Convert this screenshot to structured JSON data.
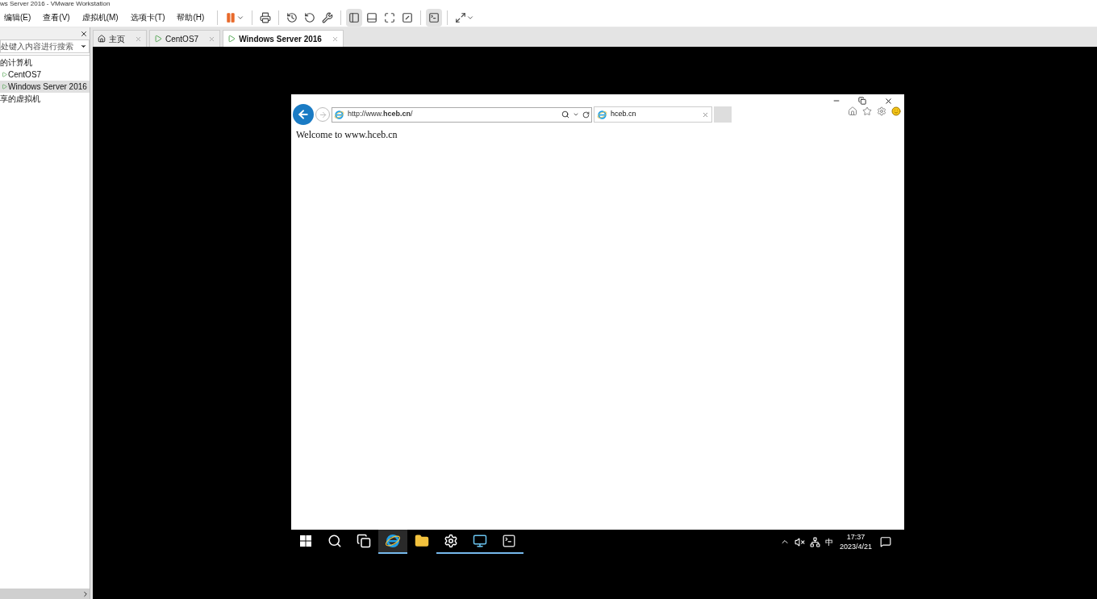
{
  "window": {
    "title": "ws Server 2016 - VMware Workstation"
  },
  "menu": [
    "编辑(E)",
    "查看(V)",
    "虚拟机(M)",
    "选项卡(T)",
    "帮助(H)"
  ],
  "toolbar": [
    {
      "kind": "pause",
      "selected": false
    },
    {
      "kind": "send-keys",
      "selected": false
    },
    {
      "kind": "snapshot",
      "selected": false
    },
    {
      "kind": "revert",
      "selected": false
    },
    {
      "kind": "manage",
      "selected": false
    },
    {
      "kind": "sidebar",
      "selected": true
    },
    {
      "kind": "thumb",
      "selected": false
    },
    {
      "kind": "fullscreen",
      "selected": false
    },
    {
      "kind": "unity",
      "selected": false
    },
    {
      "kind": "console",
      "selected": true
    },
    {
      "kind": "stretch",
      "selected": false
    }
  ],
  "library": {
    "search": {
      "placeholder": "处键入内容进行搜索"
    },
    "items": [
      {
        "label": "的计算机",
        "selected": false,
        "children": [
          {
            "label": "CentOS7",
            "kind": "vm",
            "selected": false
          },
          {
            "label": "Windows Server 2016",
            "kind": "vm",
            "selected": true
          }
        ]
      },
      {
        "label": "享的虚拟机",
        "selected": false
      }
    ]
  },
  "tabs": [
    {
      "label": "主页",
      "kind": "home",
      "selected": false
    },
    {
      "label": "CentOS7",
      "kind": "vm",
      "selected": false
    },
    {
      "label": "Windows Server 2016",
      "kind": "vm",
      "selected": true
    }
  ],
  "browser": {
    "address": "http://www.**hceb.cn**/",
    "tab": "hceb.cn",
    "content": "Welcome to www.hceb.cn"
  },
  "taskbar": {
    "apps": [
      {
        "kind": "start",
        "selected": false,
        "running": false
      },
      {
        "kind": "search",
        "selected": false,
        "running": false
      },
      {
        "kind": "taskview",
        "selected": false,
        "running": false
      },
      {
        "kind": "ie",
        "selected": true,
        "running": true
      },
      {
        "kind": "explorer",
        "selected": false,
        "running": false
      },
      {
        "kind": "settings",
        "selected": false,
        "running": true
      },
      {
        "kind": "server",
        "selected": false,
        "running": true
      },
      {
        "kind": "cmd",
        "selected": false,
        "running": true
      }
    ],
    "ime": "中",
    "time": "17:37",
    "date": "2023/4/21"
  }
}
